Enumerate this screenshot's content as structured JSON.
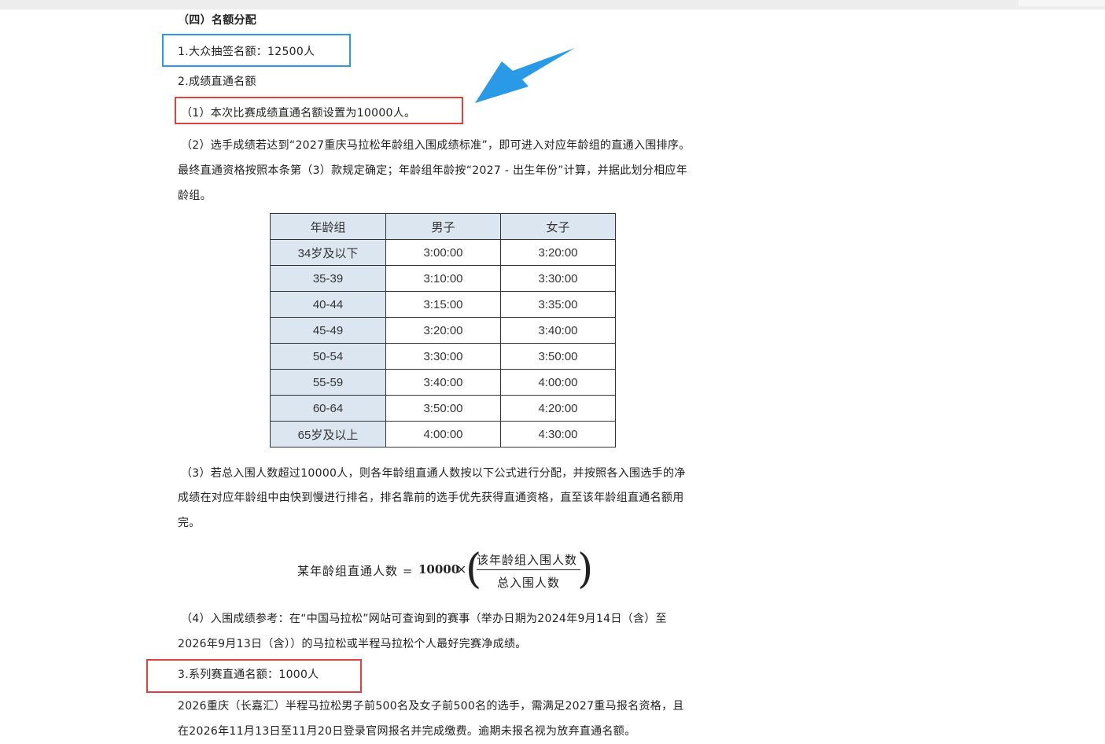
{
  "section_heading": "（四）名额分配",
  "item1": "1.大众抽签名额：12500人",
  "item2": "2.成绩直通名额",
  "item2_1": "（1）本次比赛成绩直通名额设置为10000人。",
  "item2_2_lines": [
    "（2）选手成绩若达到“2027重庆马拉松年龄组入围成绩标准”，即可进入对应年龄组的直通入围排序。",
    "最终直通资格按照本条第（3）款规定确定；年龄组年龄按“2027 - 出生年份”计算，并据此划分相应年",
    "龄组。"
  ],
  "table": {
    "headers": [
      "年龄组",
      "男子",
      "女子"
    ],
    "rows": [
      [
        "34岁及以下",
        "3:00:00",
        "3:20:00"
      ],
      [
        "35-39",
        "3:10:00",
        "3:30:00"
      ],
      [
        "40-44",
        "3:15:00",
        "3:35:00"
      ],
      [
        "45-49",
        "3:20:00",
        "3:40:00"
      ],
      [
        "50-54",
        "3:30:00",
        "3:50:00"
      ],
      [
        "55-59",
        "3:40:00",
        "4:00:00"
      ],
      [
        "60-64",
        "3:50:00",
        "4:20:00"
      ],
      [
        "65岁及以上",
        "4:00:00",
        "4:30:00"
      ]
    ]
  },
  "item2_3_lines": [
    "（3）若总入围人数超过10000人，则各年龄组直通人数按以下公式进行分配，并按照各入围选手的净",
    "成绩在对应年龄组中由快到慢进行排名，排名靠前的选手优先获得直通资格，直至该年龄组直通名额用",
    "完。"
  ],
  "formula": {
    "lhs": "某年龄组直通人数 =",
    "number": "10000",
    "times": "×",
    "numerator": "该年龄组入围人数",
    "denominator": "总入围人数"
  },
  "item2_4_lines": [
    "（4）入围成绩参考：在“中国马拉松”网站可查询到的赛事（举办日期为2024年9月14日（含）至",
    "2026年9月13日（含））的马拉松或半程马拉松个人最好完赛净成绩。"
  ],
  "item3": "3.系列赛直通名额：1000人",
  "item3_lines": [
    "2026重庆（长嘉汇）半程马拉松男子前500名及女子前500名的选手，需满足2027重马报名资格，且",
    "在2026年11月13日至11月20日登录官网报名并完成缴费。逾期未报名视为放弃直通名额。"
  ],
  "colors": {
    "highlight_blue": "#2c9be0",
    "highlight_red": "#e2403e",
    "arrow_blue": "#2a9ae6",
    "table_header_bg": "#dce6f1"
  },
  "icons": [
    "pointer-arrow-icon"
  ]
}
